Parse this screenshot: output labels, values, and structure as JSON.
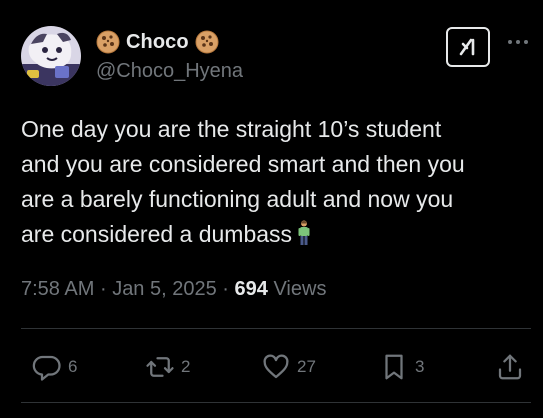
{
  "author": {
    "display_name": "Choco",
    "handle": "@Choco_Hyena",
    "name_prefix_emoji": "cookie-icon",
    "name_suffix_emoji": "cookie-icon"
  },
  "tweet": {
    "lines": [
      "One day you are the straight 10’s student",
      "and you are considered smart and then you",
      "are a barely functioning adult and now you",
      "are considered a dumbass"
    ],
    "trailing_emoji": "person-standing-emoji"
  },
  "meta": {
    "time": "7:58 AM",
    "separator": "·",
    "date": "Jan 5, 2025",
    "views_count": "694",
    "views_label": "Views"
  },
  "actions": {
    "replies": "6",
    "reposts": "2",
    "likes": "27",
    "bookmarks": "3"
  },
  "colors": {
    "background": "#000000",
    "text_primary": "#e7e9ea",
    "text_secondary": "#71767b",
    "divider": "#2f3336"
  }
}
